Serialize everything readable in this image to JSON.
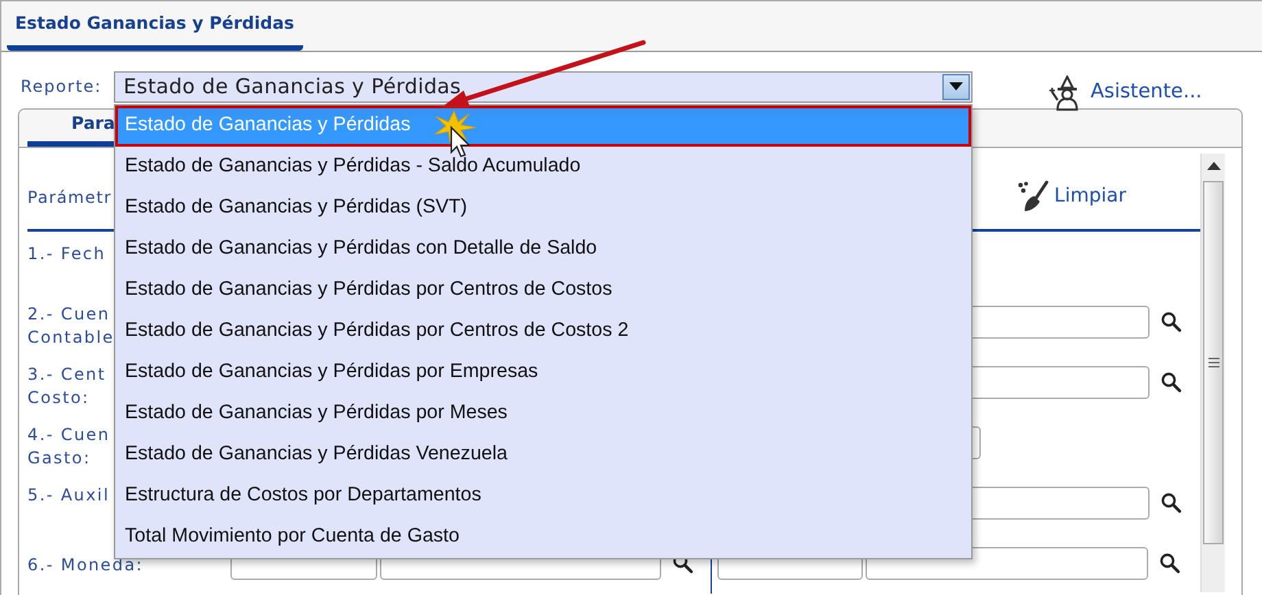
{
  "page_tab": {
    "label": "Estado Ganancias y Pérdidas",
    "selected": true
  },
  "report": {
    "label": "Reporte:",
    "value": "Estado de Ganancias y Pérdidas",
    "expanded": true,
    "options": [
      {
        "label": "Estado de Ganancias y Pérdidas",
        "selected": true
      },
      {
        "label": "Estado de Ganancias y Pérdidas - Saldo Acumulado",
        "selected": false
      },
      {
        "label": "Estado de Ganancias y Pérdidas (SVT)",
        "selected": false
      },
      {
        "label": "Estado de Ganancias y Pérdidas con Detalle de Saldo",
        "selected": false
      },
      {
        "label": "Estado de Ganancias y Pérdidas por Centros de Costos",
        "selected": false
      },
      {
        "label": "Estado de Ganancias y Pérdidas por Centros de Costos 2",
        "selected": false
      },
      {
        "label": "Estado de Ganancias y Pérdidas por Empresas",
        "selected": false
      },
      {
        "label": "Estado de Ganancias y Pérdidas por Meses",
        "selected": false
      },
      {
        "label": "Estado de Ganancias y Pérdidas Venezuela",
        "selected": false
      },
      {
        "label": "Estructura de Costos por Departamentos",
        "selected": false
      },
      {
        "label": "Total Movimiento por Cuenta de Gasto",
        "selected": false
      }
    ]
  },
  "wizard": {
    "label": "Asistente..."
  },
  "inner_tab": {
    "label": "Para",
    "selected": true
  },
  "params_title": "Parámetr",
  "clear": {
    "label": "Limpiar"
  },
  "params": [
    {
      "lines": [
        "1.- Fech"
      ],
      "kind": "none"
    },
    {
      "lines": [
        "2.- Cuen",
        "Contable"
      ],
      "kind": "search"
    },
    {
      "lines": [
        "3.- Cent",
        "Costo:"
      ],
      "kind": "search"
    },
    {
      "lines": [
        "4.- Cuen",
        "Gasto:"
      ],
      "kind": "short"
    },
    {
      "lines": [
        "5.- Auxil"
      ],
      "kind": "search"
    },
    {
      "lines": [
        "6.- Moneda:"
      ],
      "kind": "range"
    }
  ]
}
